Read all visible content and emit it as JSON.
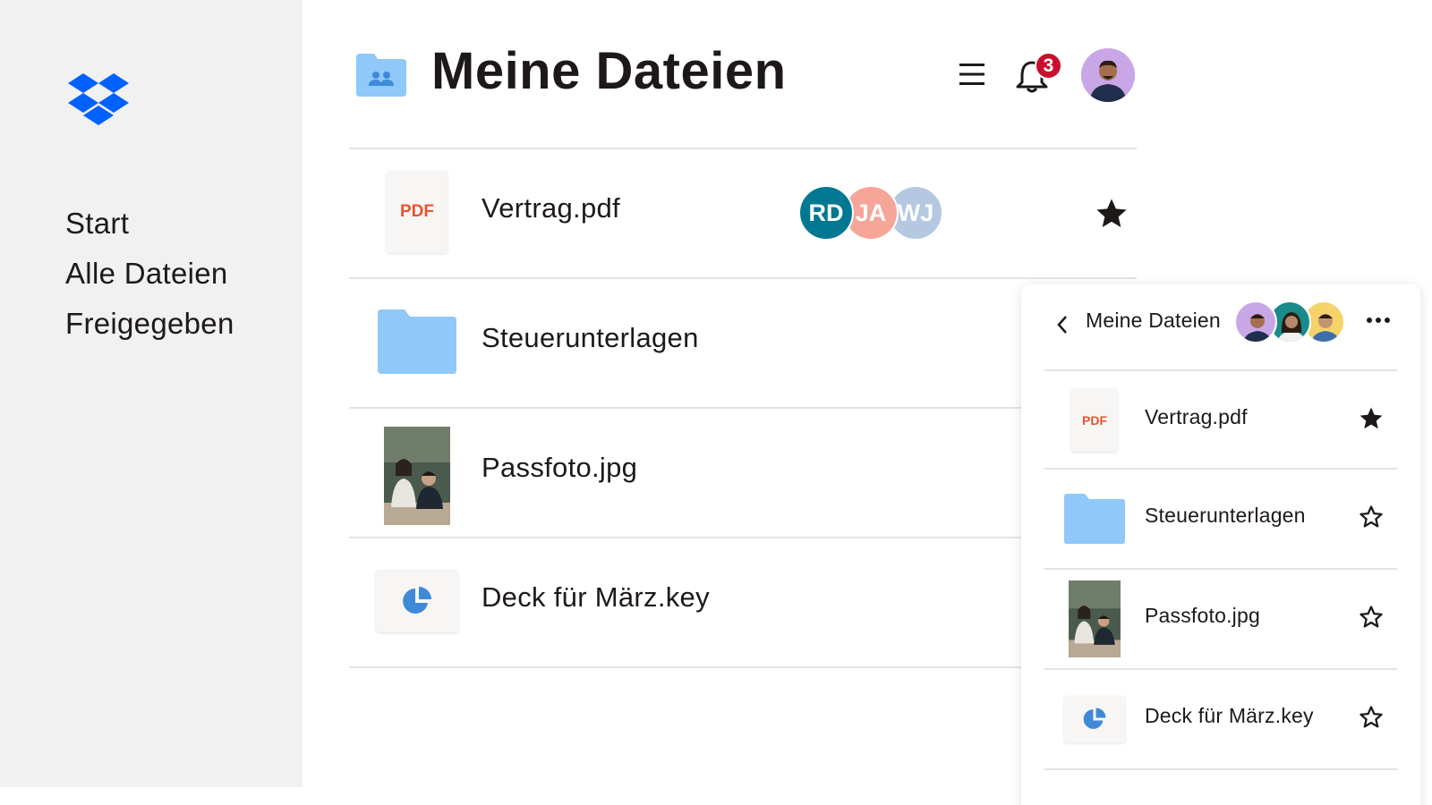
{
  "sidebar": {
    "logo_icon": "dropbox-logo",
    "items": [
      {
        "label": "Start"
      },
      {
        "label": "Alle Dateien"
      },
      {
        "label": "Freigegeben"
      }
    ]
  },
  "header": {
    "title": "Meine Dateien",
    "folder_icon": "shared-folder-icon",
    "menu_icon": "hamburger-menu-icon",
    "notification_icon": "bell-icon",
    "notification_count": "3"
  },
  "files": [
    {
      "name": "Vertrag.pdf",
      "type_label": "PDF",
      "starred": true,
      "collaborators": [
        "RD",
        "JA",
        "WJ"
      ]
    },
    {
      "name": "Steuerunterlagen",
      "starred": false
    },
    {
      "name": "Passfoto.jpg",
      "starred": false
    },
    {
      "name": "Deck für März.key",
      "starred": false
    }
  ],
  "panel": {
    "title": "Meine Dateien",
    "back_icon": "chevron-left-icon",
    "more_icon": "more-horizontal-icon",
    "items": [
      {
        "name": "Vertrag.pdf",
        "type_label": "PDF",
        "starred": true
      },
      {
        "name": "Steuerunterlagen",
        "starred": false
      },
      {
        "name": "Passfoto.jpg",
        "starred": false
      },
      {
        "name": "Deck für März.key",
        "starred": false
      }
    ]
  },
  "colors": {
    "brand_blue": "#0061fe",
    "folder_blue": "#90c8f9",
    "pdf_red": "#e8542e",
    "badge_red": "#c8102e",
    "collab_rd": "#007891",
    "collab_ja": "#f6a699",
    "collab_wj": "#b4c8e1"
  }
}
